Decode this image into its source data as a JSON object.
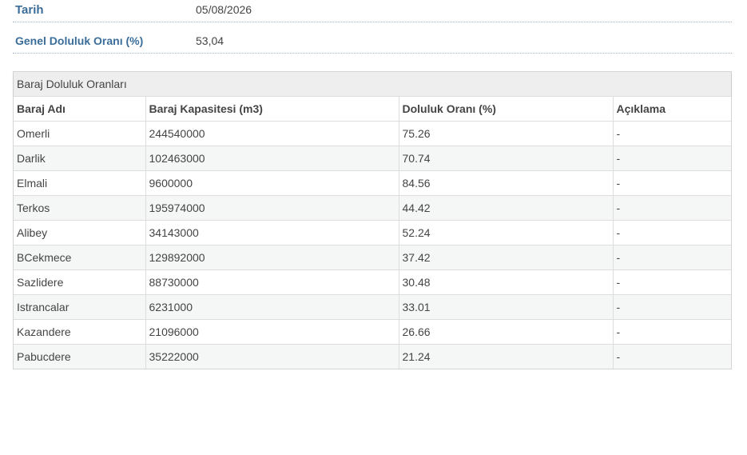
{
  "summary": {
    "date_label": "Tarih",
    "date_value": "05/08/2026",
    "overall_label": "Genel Doluluk Oranı (%)",
    "overall_value": "53,04"
  },
  "panel": {
    "title": "Baraj Doluluk Oranları"
  },
  "table": {
    "headers": [
      "Baraj Adı",
      "Baraj Kapasitesi (m3)",
      "Doluluk Oranı (%)",
      "Açıklama"
    ],
    "rows": [
      [
        "Omerli",
        "244540000",
        "75.26",
        "-"
      ],
      [
        "Darlik",
        "102463000",
        "70.74",
        "-"
      ],
      [
        "Elmali",
        "9600000",
        "84.56",
        "-"
      ],
      [
        "Terkos",
        "195974000",
        "44.42",
        "-"
      ],
      [
        "Alibey",
        "34143000",
        "52.24",
        "-"
      ],
      [
        "BCekmece",
        "129892000",
        "37.42",
        "-"
      ],
      [
        "Sazlidere",
        "88730000",
        "30.48",
        "-"
      ],
      [
        "Istrancalar",
        "6231000",
        "33.01",
        "-"
      ],
      [
        "Kazandere",
        "21096000",
        "26.66",
        "-"
      ],
      [
        "Pabucdere",
        "35222000",
        "21.24",
        "-"
      ]
    ]
  },
  "colors": {
    "label_blue": "#3a6d99",
    "row_alt": "#f5f7f7",
    "heading_bg": "#eeeeee"
  }
}
